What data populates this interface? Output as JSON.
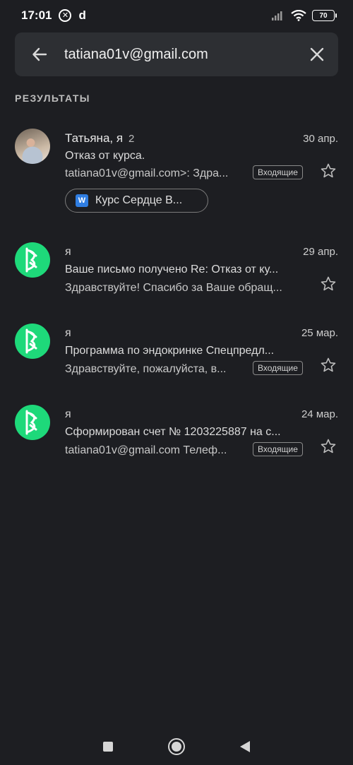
{
  "status_bar": {
    "time": "17:01",
    "notif_app_letter": "d",
    "battery": "70"
  },
  "search": {
    "query": "tatiana01v@gmail.com"
  },
  "section_label": "РЕЗУЛЬТАТЫ",
  "emails": [
    {
      "sender": "Татьяна, я",
      "thread_count": "2",
      "date": "30 апр.",
      "subject": "Отказ от курса.",
      "snippet": "tatiana01v@gmail.com>: Здра...",
      "label": "Входящие",
      "attachment": "Курс Сердце  В...",
      "attachment_icon": "W"
    },
    {
      "sender": "я",
      "date": "29 апр.",
      "subject": "Ваше письмо получено Re: Отказ от ку...",
      "snippet": "Здравствуйте! Спасибо за Ваше обращ..."
    },
    {
      "sender": "я",
      "date": "25 мар.",
      "subject": "Программа по эндокринке Спецпредл...",
      "snippet": "Здравствуйте, пожалуйста, в...",
      "label": "Входящие"
    },
    {
      "sender": "я",
      "date": "24 мар.",
      "subject": "Сформирован счет № 1203225887 на с...",
      "snippet": "tatiana01v@gmail.com Телеф...",
      "label": "Входящие"
    }
  ],
  "colors": {
    "background": "#1d1e22",
    "search_bar": "#2d2f33",
    "avatar_green": "#1ed97a"
  }
}
